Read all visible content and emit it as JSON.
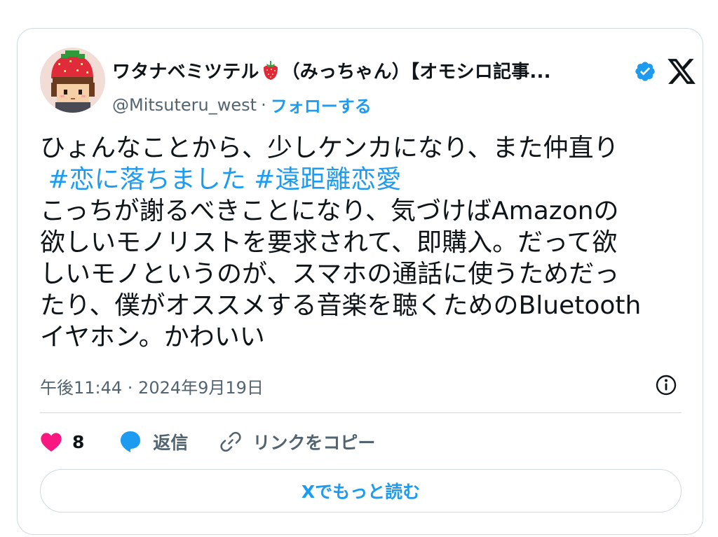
{
  "author": {
    "name_prefix": "ワタナベミツテル",
    "name_suffix": "（みっちゃん）【オモシロ記事...",
    "handle": "@Mitsuteru_west",
    "separator": "·",
    "follow_label": "フォローする",
    "verified": true
  },
  "tweet": {
    "line1": "ひょんなことから、少しケンカになり、また仲直り",
    "hashtag1": "#恋に落ちました",
    "hashtag2": "#遠距離恋愛",
    "body_lines": [
      "こっちが謝るべきことになり、気づけばAmazonの",
      "欲しいモノリストを要求されて、即購入。だって欲",
      "しいモノというのが、スマホの通話に使うためだっ",
      "たり、僕がオススメする音楽を聴くためのBluetooth",
      "イヤホン。かわいい"
    ]
  },
  "meta": {
    "timestamp": "午後11:44 · 2024年9月19日"
  },
  "actions": {
    "like_count": "8",
    "reply_label": "返信",
    "copy_link_label": "リンクをコピー"
  },
  "read_more_label": "Xでもっと読む",
  "colors": {
    "accent": "#1d9bf0",
    "like": "#f91880",
    "border": "#cfd9de",
    "secondary_text": "#536471"
  },
  "icons": [
    "strawberry-emoji-icon",
    "verified-badge-icon",
    "x-logo-icon",
    "info-icon",
    "heart-icon",
    "reply-bubble-icon",
    "link-icon"
  ]
}
